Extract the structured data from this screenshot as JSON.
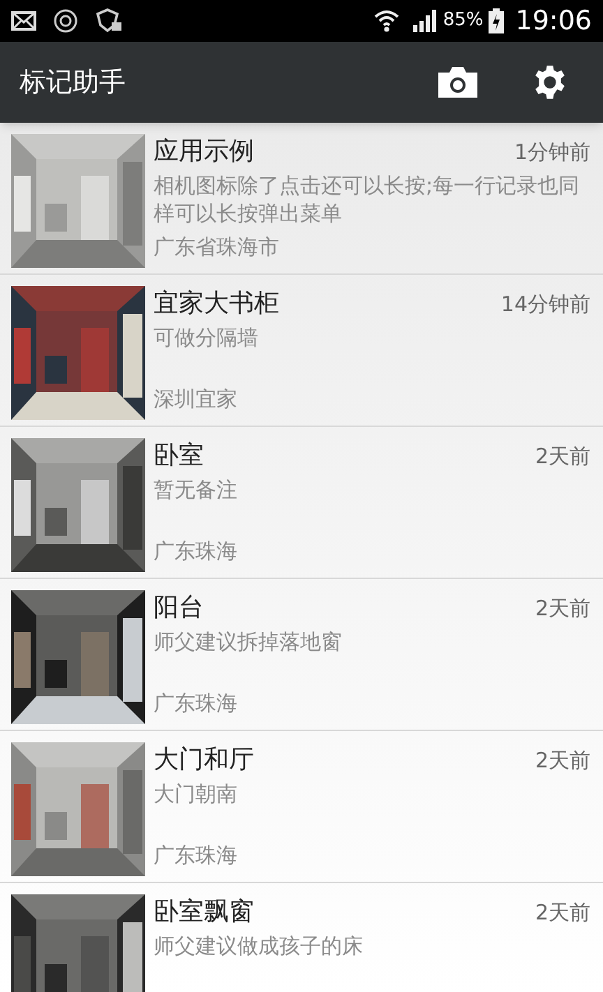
{
  "status_bar": {
    "battery": "85%",
    "time": "19:06"
  },
  "app_bar": {
    "title": "标记助手"
  },
  "records": [
    {
      "title": "应用示例",
      "time": "1分钟前",
      "note": "相机图标除了点击还可以长按;每一行记录也同样可以长按弹出菜单",
      "location": "广东省珠海市"
    },
    {
      "title": "宜家大书柜",
      "time": "14分钟前",
      "note": "可做分隔墙",
      "location": "深圳宜家"
    },
    {
      "title": "卧室",
      "time": "2天前",
      "note": "暂无备注",
      "location": "广东珠海"
    },
    {
      "title": "阳台",
      "time": "2天前",
      "note": "师父建议拆掉落地窗",
      "location": "广东珠海"
    },
    {
      "title": "大门和厅",
      "time": "2天前",
      "note": "大门朝南",
      "location": "广东珠海"
    },
    {
      "title": "卧室飘窗",
      "time": "2天前",
      "note": "师父建议做成孩子的床"
    }
  ]
}
